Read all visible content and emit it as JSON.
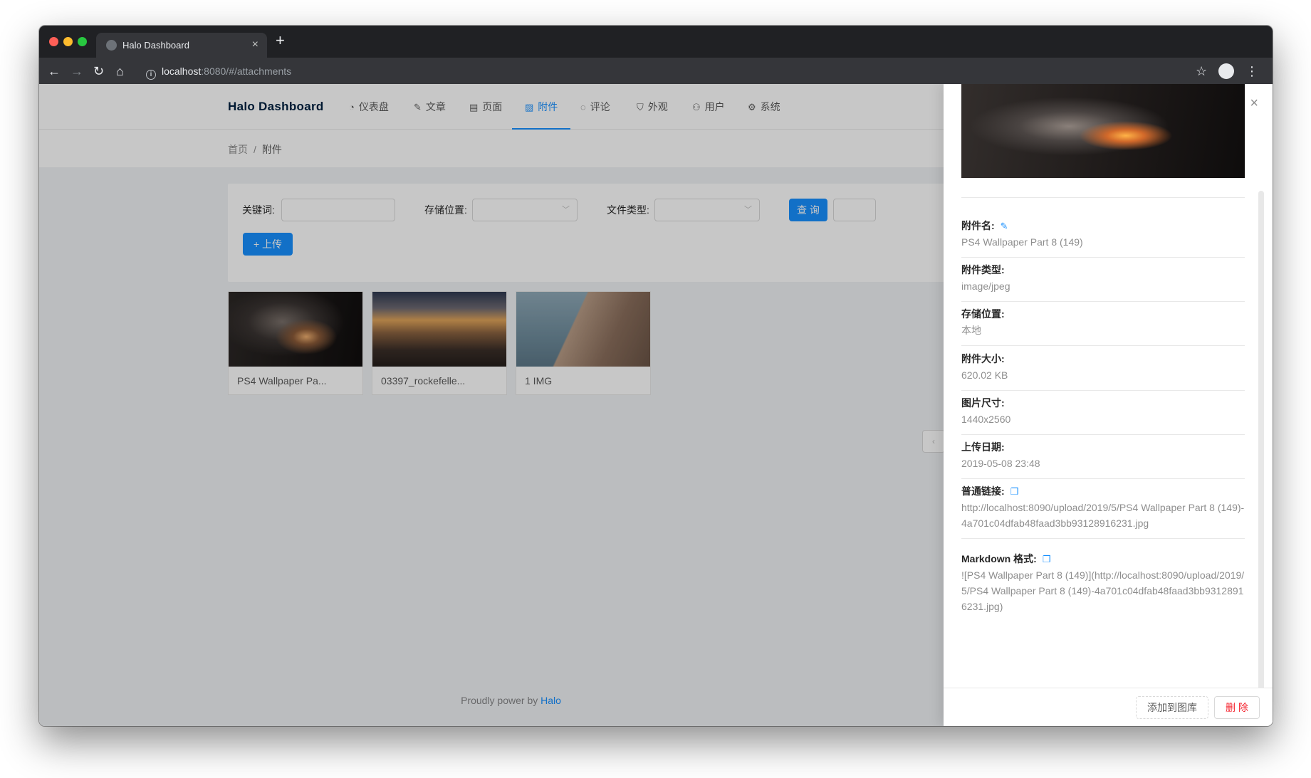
{
  "browser": {
    "tab_title": "Halo Dashboard",
    "tab_close": "×",
    "new_tab": "+",
    "url_host": "localhost",
    "url_rest": ":8080/#/attachments"
  },
  "nav": {
    "logo": "Halo  Dashboard",
    "items": [
      {
        "icon": "◔",
        "label": "仪表盘"
      },
      {
        "icon": "✎",
        "label": "文章"
      },
      {
        "icon": "▤",
        "label": "页面"
      },
      {
        "icon": "▨",
        "label": "附件"
      },
      {
        "icon": "◌",
        "label": "评论"
      },
      {
        "icon": "⛉",
        "label": "外观"
      },
      {
        "icon": "⚇",
        "label": "用户"
      },
      {
        "icon": "⚙",
        "label": "系统"
      }
    ]
  },
  "breadcrumb": {
    "home": "首页",
    "sep": "/",
    "current": "附件"
  },
  "filters": {
    "keyword_label": "关键词:",
    "storage_label": "存储位置:",
    "type_label": "文件类型:",
    "query_button": "查 询",
    "upload_button": "+ 上传"
  },
  "attachments": [
    {
      "caption": "PS4 Wallpaper Pa..."
    },
    {
      "caption": "03397_rockefelle..."
    },
    {
      "caption": "1 IMG"
    }
  ],
  "pager": {
    "prev": "‹"
  },
  "footer": {
    "text": "Proudly power by ",
    "link": "Halo"
  },
  "drawer": {
    "close": "×",
    "fields": [
      {
        "label": "附件名:",
        "value": "PS4 Wallpaper Part 8 (149)",
        "icon": "✎"
      },
      {
        "label": "附件类型:",
        "value": "image/jpeg"
      },
      {
        "label": "存储位置:",
        "value": "本地"
      },
      {
        "label": "附件大小:",
        "value": "620.02 KB"
      },
      {
        "label": "图片尺寸:",
        "value": "1440x2560"
      },
      {
        "label": "上传日期:",
        "value": "2019-05-08 23:48"
      },
      {
        "label": "普通链接:",
        "value": "http://localhost:8090/upload/2019/5/PS4 Wallpaper Part 8 (149)-4a701c04dfab48faad3bb93128916231.jpg",
        "icon": "❐"
      },
      {
        "label": "Markdown 格式:",
        "value": "![PS4 Wallpaper Part 8 (149)](http://localhost:8090/upload/2019/5/PS4 Wallpaper Part 8 (149)-4a701c04dfab48faad3bb93128916231.jpg)",
        "icon": "❐"
      }
    ],
    "add_gallery": "添加到图库",
    "delete": "删 除"
  }
}
